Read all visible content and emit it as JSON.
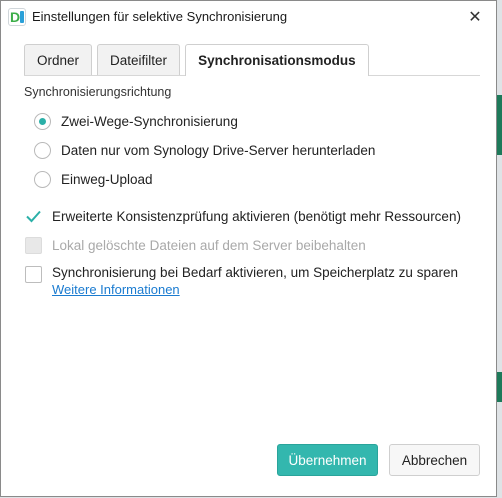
{
  "window": {
    "title": "Einstellungen für selektive Synchronisierung",
    "app_icon_letter": "D",
    "close_glyph": "✕"
  },
  "tabs": [
    {
      "label": "Ordner",
      "active": false
    },
    {
      "label": "Dateifilter",
      "active": false
    },
    {
      "label": "Synchronisationsmodus",
      "active": true
    }
  ],
  "sync_direction": {
    "title": "Synchronisierungsrichtung",
    "options": [
      {
        "label": "Zwei-Wege-Synchronisierung",
        "selected": true
      },
      {
        "label": "Daten nur vom Synology Drive-Server herunterladen",
        "selected": false
      },
      {
        "label": "Einweg-Upload",
        "selected": false
      }
    ]
  },
  "options": {
    "consistency": {
      "label": "Erweiterte Konsistenzprüfung aktivieren (benötigt mehr Ressourcen)",
      "checked": true,
      "disabled": false
    },
    "keep_deleted": {
      "label": "Lokal gelöschte Dateien auf dem Server beibehalten",
      "checked": false,
      "disabled": true
    },
    "on_demand": {
      "label": "Synchronisierung bei Bedarf aktivieren, um Speicherplatz zu sparen",
      "checked": false,
      "disabled": false,
      "link": "Weitere Informationen"
    }
  },
  "buttons": {
    "apply": "Übernehmen",
    "cancel": "Abbrechen"
  },
  "colors": {
    "accent": "#33b7ae",
    "link": "#1a7bd0"
  }
}
